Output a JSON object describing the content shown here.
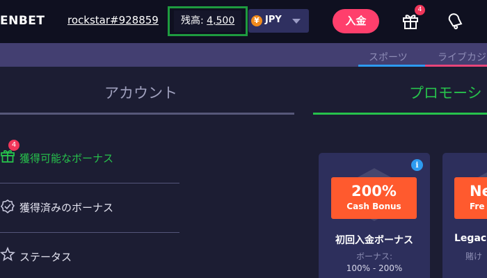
{
  "header": {
    "logo": "ENBET",
    "username": "rockstar#928859",
    "balance_label": "残高:",
    "balance_value": "4,500",
    "currency": "JPY",
    "currency_symbol": "¥",
    "deposit_label": "入金",
    "gift_badge": "4"
  },
  "subnav": {
    "sports": "スポーツ",
    "live": "ライブカジ"
  },
  "tabs": {
    "account": "アカウント",
    "promotions": "プロモーシ"
  },
  "menu": {
    "items": [
      {
        "label": "獲得可能なボーナス",
        "icon": "gift-icon",
        "badge": "4"
      },
      {
        "label": "獲得済みのボーナス",
        "icon": "badge-check-icon"
      },
      {
        "label": "ステータス",
        "icon": "star-badge-icon"
      }
    ]
  },
  "cards": [
    {
      "big": "200%",
      "small": "Cash Bonus",
      "title": "初回入金ボーナス",
      "sub": "ボーナス:",
      "range": "100% - 200%"
    },
    {
      "big": "Ne",
      "small": "Fre",
      "title": "Legac",
      "sub": "賭け"
    }
  ],
  "colors": {
    "accent_green": "#27c24c",
    "deposit_pink": "#ff3f6c",
    "badge_orange": "#ff5a2e",
    "highlight_box": "#1e9b3f"
  }
}
